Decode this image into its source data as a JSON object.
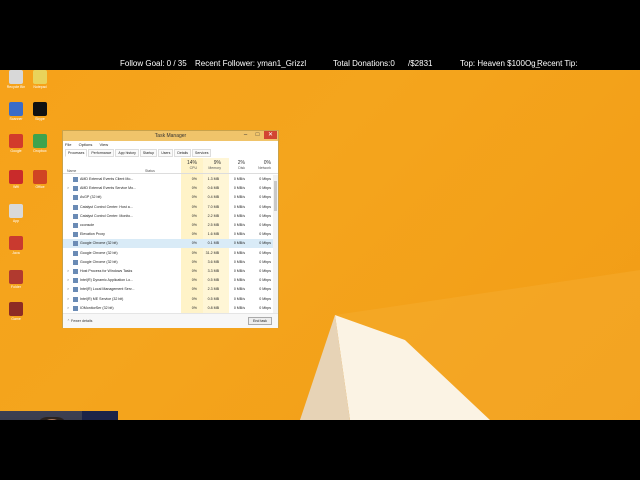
{
  "overlay": {
    "follow_goal": "Follow Goal: 0 / 35",
    "recent_follower": "Recent Follower: yman1_Grizzl",
    "total_donations": "Total Donations:0",
    "amount": "/$2831",
    "top": "Top: Heaven $100Og_",
    "recent_tip": "Recent Tip:"
  },
  "desktop_icons": [
    {
      "label": "Recycle Bin",
      "color": "#d8d8d8"
    },
    {
      "label": "Notepad",
      "color": "#e9d35a"
    },
    {
      "label": "Scanner",
      "color": "#3a6cc9"
    },
    {
      "label": "Skype",
      "color": "#111111"
    },
    {
      "label": "Google",
      "color": "#d23b2b"
    },
    {
      "label": "Dropbox",
      "color": "#3fa34d"
    },
    {
      "label": "Wifi",
      "color": "#c92b2b"
    },
    {
      "label": "Office",
      "color": "#d04423"
    },
    {
      "label": "App",
      "color": "#d9d9d9"
    },
    {
      "label": "Java",
      "color": "#c93a2f"
    },
    {
      "label": "Folder",
      "color": "#b13a2f"
    },
    {
      "label": "Game",
      "color": "#8d2b24"
    }
  ],
  "taskman": {
    "title": "Task Manager",
    "menu": [
      "File",
      "Options",
      "View"
    ],
    "tabs": [
      "Processes",
      "Performance",
      "App history",
      "Startup",
      "Users",
      "Details",
      "Services"
    ],
    "headers": {
      "name": "Name",
      "status": "Status",
      "cpu_pct": "14%",
      "cpu": "CPU",
      "mem_pct": "9%",
      "mem": "Memory",
      "disk_pct": "2%",
      "disk": "Disk",
      "net_pct": "0%",
      "net": "Network"
    },
    "rows": [
      {
        "name": "AMD External Events Client Mo...",
        "cpu": "0%",
        "mem": "1.3 MB",
        "disk": "0 MB/s",
        "net": "0 Mbps",
        "exp": ""
      },
      {
        "name": "AMD External Events Service Mo...",
        "cpu": "0%",
        "mem": "0.6 MB",
        "disk": "0 MB/s",
        "net": "0 Mbps",
        "exp": ">"
      },
      {
        "name": "AvGP (32 bit)",
        "cpu": "0%",
        "mem": "0.4 MB",
        "disk": "0 MB/s",
        "net": "0 Mbps",
        "exp": ""
      },
      {
        "name": "Catalyst Control Center: Host a...",
        "cpu": "0%",
        "mem": "7.0 MB",
        "disk": "0 MB/s",
        "net": "0 Mbps",
        "exp": ""
      },
      {
        "name": "Catalyst Control Center: Monito...",
        "cpu": "0%",
        "mem": "2.2 MB",
        "disk": "0 MB/s",
        "net": "0 Mbps",
        "exp": ""
      },
      {
        "name": "cconsole",
        "cpu": "0%",
        "mem": "2.5 MB",
        "disk": "0 MB/s",
        "net": "0 Mbps",
        "exp": ""
      },
      {
        "name": "Elevation Proxy",
        "cpu": "0%",
        "mem": "1.6 MB",
        "disk": "0 MB/s",
        "net": "0 Mbps",
        "exp": ""
      },
      {
        "name": "Google Chrome (32 bit)",
        "cpu": "0%",
        "mem": "0.1 MB",
        "disk": "0 MB/s",
        "net": "0 Mbps",
        "exp": ""
      },
      {
        "name": "Google Chrome (32 bit)",
        "cpu": "0%",
        "mem": "31.2 MB",
        "disk": "0 MB/s",
        "net": "0 Mbps",
        "exp": ""
      },
      {
        "name": "Google Chrome (32 bit)",
        "cpu": "0%",
        "mem": "3.6 MB",
        "disk": "0 MB/s",
        "net": "0 Mbps",
        "exp": ""
      },
      {
        "name": "Host Process for Windows Tasks",
        "cpu": "0%",
        "mem": "3.3 MB",
        "disk": "0 MB/s",
        "net": "0 Mbps",
        "exp": ">"
      },
      {
        "name": "Intel(R) Dynamic Application Lo...",
        "cpu": "0%",
        "mem": "0.5 MB",
        "disk": "0 MB/s",
        "net": "0 Mbps",
        "exp": ">"
      },
      {
        "name": "Intel(R) Local Management Serv...",
        "cpu": "0%",
        "mem": "2.3 MB",
        "disk": "0 MB/s",
        "net": "0 Mbps",
        "exp": ">"
      },
      {
        "name": "Intel(R) ME Service (32 bit)",
        "cpu": "0%",
        "mem": "0.5 MB",
        "disk": "0 MB/s",
        "net": "0 Mbps",
        "exp": ">"
      },
      {
        "name": "IOMonitorSer (32 bit)",
        "cpu": "0%",
        "mem": "0.8 MB",
        "disk": "0 MB/s",
        "net": "0 Mbps",
        "exp": ">"
      }
    ],
    "selected_row": 7,
    "fewer_details": "Fewer details",
    "end_task": "End task"
  }
}
